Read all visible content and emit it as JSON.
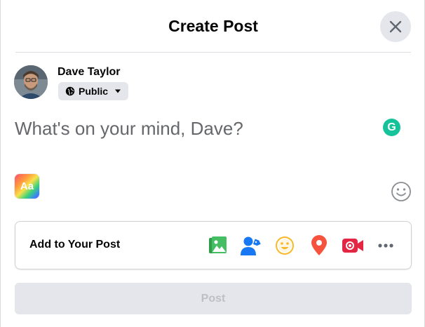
{
  "dialog": {
    "title": "Create Post"
  },
  "user": {
    "name": "Dave Taylor",
    "privacy_label": "Public"
  },
  "composer": {
    "placeholder": "What's on your mind, Dave?",
    "value": ""
  },
  "tools": {
    "text_style_label": "Aa",
    "grammarly_label": "G"
  },
  "add_to_post": {
    "label": "Add to Your Post",
    "options": [
      {
        "name": "photo-video-icon",
        "color": "#45bd62"
      },
      {
        "name": "tag-people-icon",
        "color": "#1877f2"
      },
      {
        "name": "feeling-activity-icon",
        "color": "#f7b928"
      },
      {
        "name": "check-in-icon",
        "color": "#f5533d"
      },
      {
        "name": "live-video-icon",
        "color": "#e42645"
      },
      {
        "name": "more-icon",
        "color": "#606770"
      }
    ]
  },
  "post_button": {
    "label": "Post"
  },
  "colors": {
    "accent": "#1877f2",
    "button_bg": "#e4e6eb",
    "disabled_text": "#bcc0c4",
    "placeholder_text": "#65676b"
  }
}
